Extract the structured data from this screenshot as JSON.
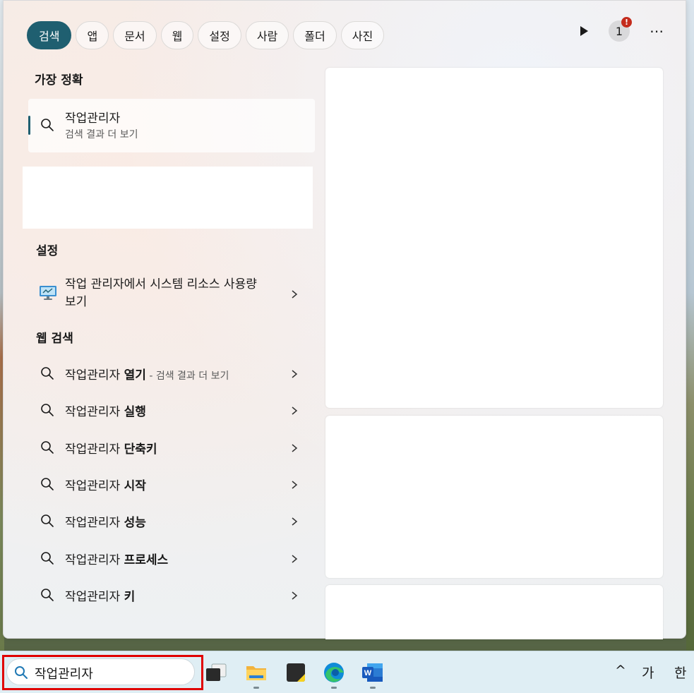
{
  "filters": {
    "chips": [
      "검색",
      "앱",
      "문서",
      "웹",
      "설정",
      "사람",
      "폴더",
      "사진"
    ],
    "active": "검색"
  },
  "top_actions": {
    "badge_count": "1",
    "badge_alert": "!",
    "more_label": "⋯"
  },
  "best_match": {
    "heading": "가장 정확",
    "title": "작업관리자",
    "subtitle": "검색 결과 더 보기"
  },
  "settings": {
    "heading": "설정",
    "item_label": "작업 관리자에서 시스템 리소스 사용량 보기"
  },
  "web_search": {
    "heading": "웹 검색",
    "query": "작업관리자",
    "items": [
      {
        "bold": "열기",
        "hint": " - 검색 결과 더 보기"
      },
      {
        "bold": "실행",
        "hint": ""
      },
      {
        "bold": "단축키",
        "hint": ""
      },
      {
        "bold": "시작",
        "hint": ""
      },
      {
        "bold": "성능",
        "hint": ""
      },
      {
        "bold": "프로세스",
        "hint": ""
      },
      {
        "bold": "키",
        "hint": ""
      }
    ]
  },
  "taskbar": {
    "search_value": "작업관리자",
    "apps": [
      "task-view-icon",
      "file-explorer-icon",
      "sticky-notes-icon",
      "edge-icon",
      "word-icon"
    ],
    "tray": {
      "chevron": "^",
      "ime_mode": "가",
      "language": "한"
    }
  },
  "colors": {
    "accent": "#1f5f70",
    "highlight": "#e00000",
    "badge": "#c42b1c"
  }
}
